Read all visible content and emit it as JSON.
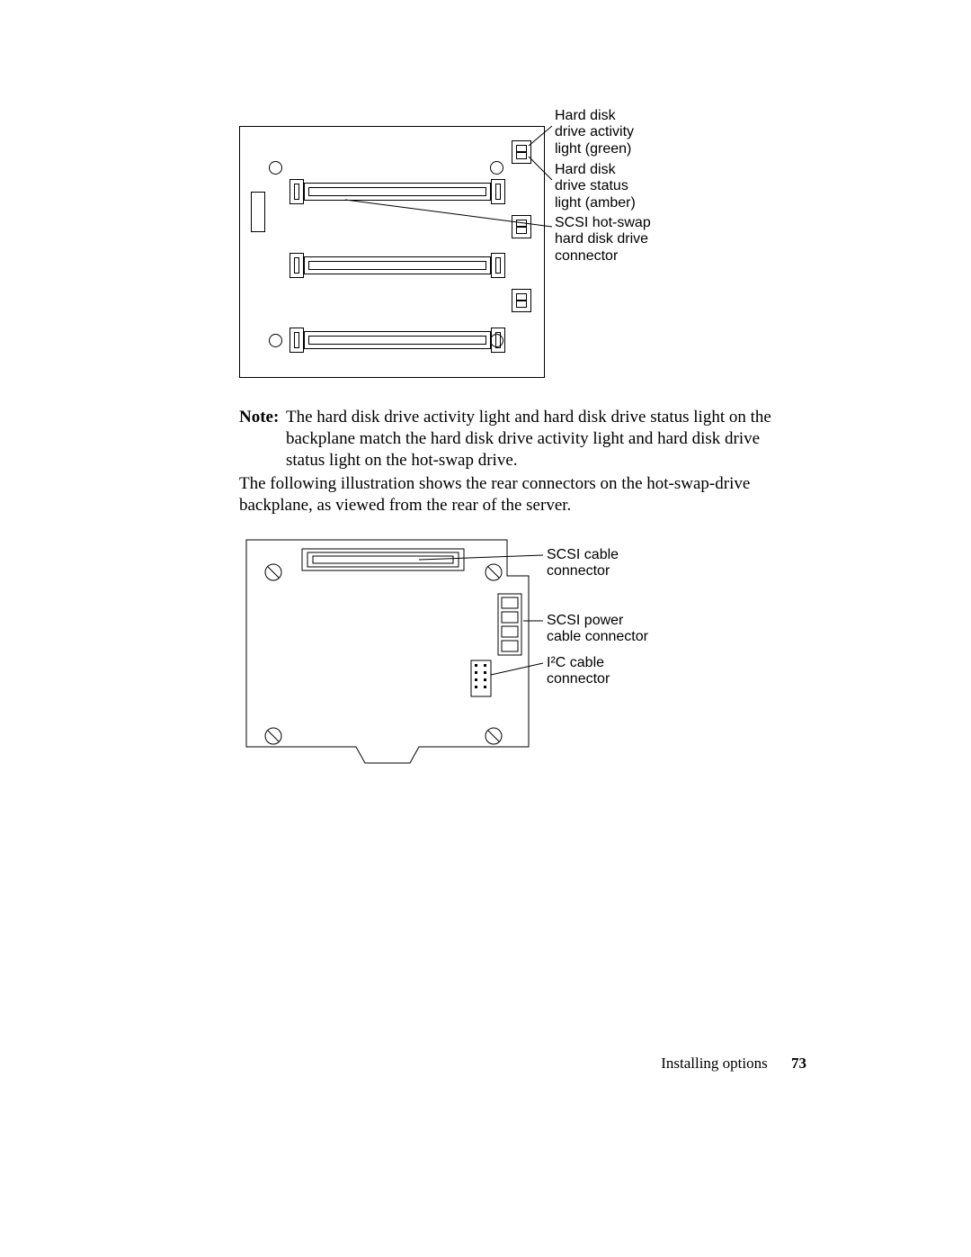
{
  "fig1": {
    "callouts": {
      "activity_light": "Hard disk\ndrive activity\nlight (green)",
      "status_light": "Hard disk\ndrive status\nlight (amber)",
      "connector": "SCSI hot-swap\nhard disk drive\nconnector"
    }
  },
  "note": {
    "label": "Note:",
    "text": "The hard disk drive activity light and hard disk drive status light on the backplane match the hard disk drive activity light and hard disk drive status light on the hot-swap drive."
  },
  "paragraph": "The following illustration shows the rear connectors on the hot-swap-drive backplane, as viewed from the rear of the server.",
  "fig2": {
    "callouts": {
      "scsi_cable": "SCSI cable\nconnector",
      "scsi_power": "SCSI power\ncable connector",
      "i2c_cable": "I²C cable\nconnector"
    }
  },
  "footer": {
    "section": "Installing options",
    "page": "73"
  }
}
